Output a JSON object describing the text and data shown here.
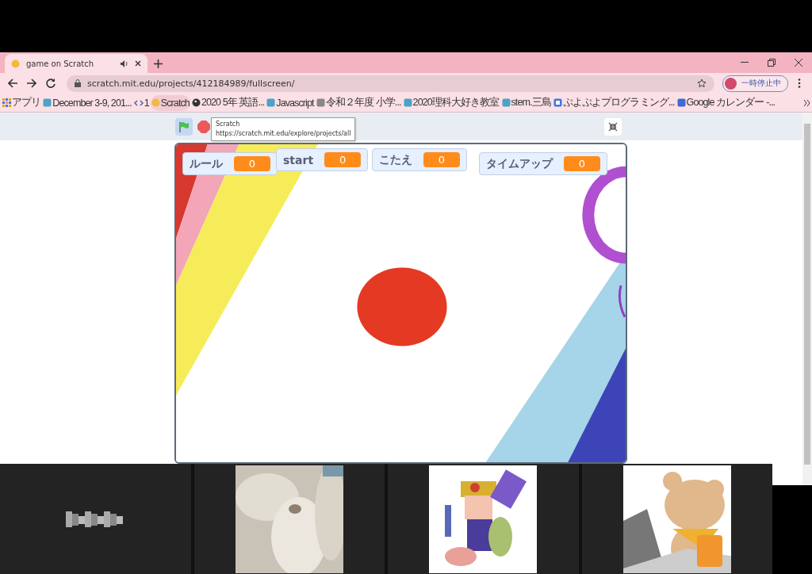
{
  "tab": {
    "title": "game on Scratch",
    "audio": true
  },
  "url": "scratch.mit.edu/projects/412184989/fullscreen/",
  "profile": {
    "label": "一時停止中"
  },
  "bookmarks": [
    {
      "label": "アプリ"
    },
    {
      "label": "December 3-9, 201..."
    },
    {
      "label": "1"
    },
    {
      "label": "Scratch",
      "hovered": true
    },
    {
      "label": "2020 5年 英語..."
    },
    {
      "label": "Javascript"
    },
    {
      "label": "令和２年度 小学..."
    },
    {
      "label": "2020理科大好き教室"
    },
    {
      "label": "stem.三島"
    },
    {
      "label": "ぷよぷよプログラミング..."
    },
    {
      "label": "Google カレンダー -..."
    }
  ],
  "tooltip": {
    "title": "Scratch",
    "url": "https://scratch.mit.edu/explore/projects/all"
  },
  "monitors": [
    {
      "label": "ルール",
      "value": "0"
    },
    {
      "label": "start",
      "value": "0"
    },
    {
      "label": "こたえ",
      "value": "0"
    },
    {
      "label": "タイムアップ",
      "value": "0"
    }
  ],
  "video_tiles": [
    {
      "kind": "blurred-name"
    },
    {
      "kind": "picture"
    },
    {
      "kind": "picture"
    },
    {
      "kind": "picture"
    }
  ]
}
